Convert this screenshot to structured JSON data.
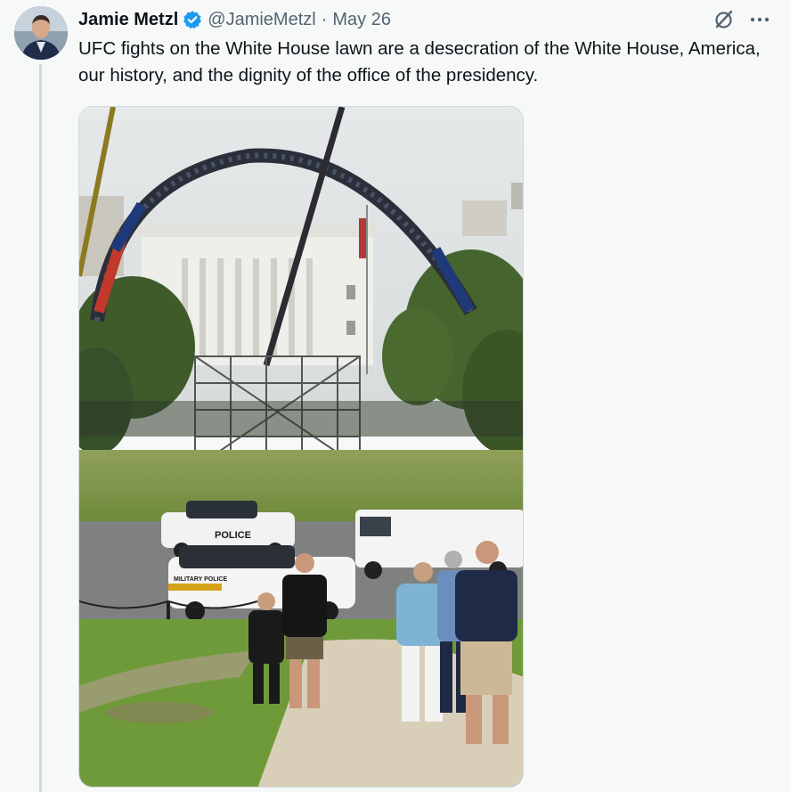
{
  "tweet": {
    "author_name": "Jamie Metzl",
    "handle": "@JamieMetzl",
    "separator": "·",
    "date": "May 26",
    "text": "UFC fights on the White House lawn are a desecration of the White House, America, our history, and the dignity of the office of the presidency.",
    "verified": true
  },
  "icons": {
    "verified": "verified-badge-icon",
    "grok": "grok-icon",
    "more": "more-options-icon"
  },
  "photo": {
    "police_text": "POLICE",
    "military_police_text": "MILITARY POLICE"
  },
  "colors": {
    "verified_blue": "#1d9bf0",
    "text_primary": "#0f1419",
    "text_secondary": "#536471"
  }
}
